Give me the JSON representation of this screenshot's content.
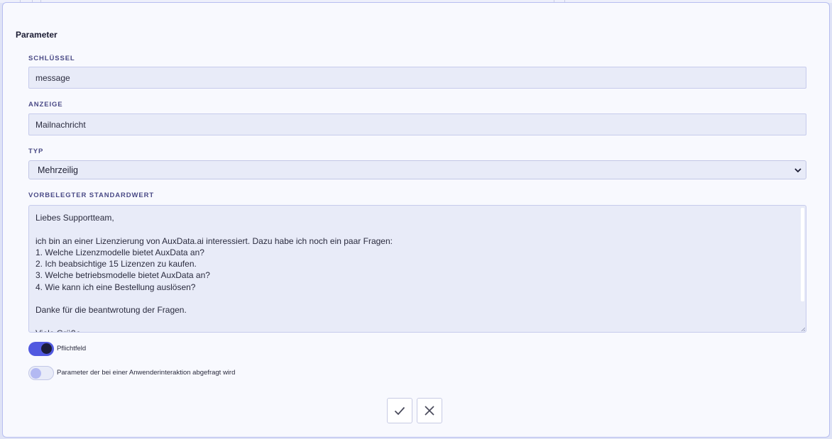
{
  "section": {
    "title": "Parameter"
  },
  "fields": {
    "key": {
      "label": "Schlüssel",
      "value": "message"
    },
    "display": {
      "label": "Anzeige",
      "value": "Mailnachricht"
    },
    "type": {
      "label": "Typ",
      "selected": "Mehrzeilig"
    },
    "default_value": {
      "label": "Vorbelegter Standardwert",
      "value": "Liebes Supportteam,\n\nich bin an einer Lizenzierung von AuxData.ai interessiert. Dazu habe ich noch ein paar Fragen:\n1. Welche Lizenzmodelle bietet AuxData an?\n2. Ich beabsichtige 15 Lizenzen zu kaufen.\n3. Welche betriebsmodelle bietet AuxData an?\n4. Wie kann ich eine Bestellung auslösen?\n\nDanke für die beantwrotung der Fragen.\n\nViele Grüße"
    }
  },
  "toggles": {
    "required": {
      "label": "Pflichtfeld",
      "on": true
    },
    "interaction": {
      "label": "Parameter der bei einer Anwenderinteraktion abgefragt wird",
      "on": false
    }
  },
  "actions": {
    "confirm_icon": "check-icon",
    "cancel_icon": "close-icon"
  },
  "colors": {
    "accent": "#5159e0",
    "panel_border": "#b7bef0",
    "field_bg": "#e8ebf8"
  }
}
